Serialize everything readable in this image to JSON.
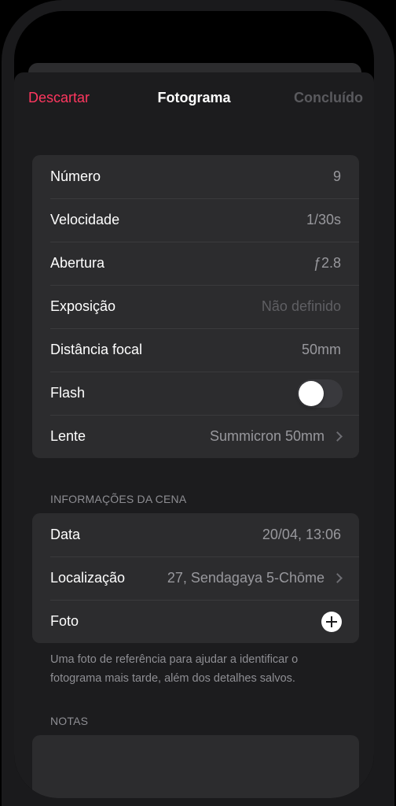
{
  "navbar": {
    "discard_label": "Descartar",
    "title": "Fotograma",
    "done_label": "Concluído"
  },
  "frame_details": [
    {
      "label": "Número",
      "value": "9"
    },
    {
      "label": "Velocidade",
      "value": "1/30s"
    },
    {
      "label": "Abertura",
      "value": "ƒ2.8"
    },
    {
      "label": "Exposição",
      "value": "Não definido"
    },
    {
      "label": "Distância focal",
      "value": "50mm"
    },
    {
      "label": "Flash",
      "toggle_on": false
    },
    {
      "label": "Lente",
      "value": "Summicron 50mm"
    }
  ],
  "scene": {
    "header": "INFORMAÇÕES DA CENA",
    "rows": [
      {
        "label": "Data",
        "value": "20/04, 13:06"
      },
      {
        "label": "Localização",
        "value": "27, Sendagaya 5-Chōme"
      },
      {
        "label": "Foto",
        "icon": "add-circle-icon"
      }
    ],
    "footer": "Uma foto de referência para ajudar a identificar o fotograma mais tarde, além dos detalhes salvos."
  },
  "notes": {
    "header": "NOTAS"
  },
  "colors": {
    "accent_destructive": "#ff375f",
    "sheet_background": "#1c1c1e",
    "group_background": "#2c2c2e"
  }
}
